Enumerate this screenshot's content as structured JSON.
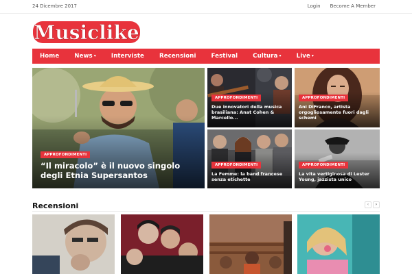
{
  "topbar": {
    "date": "24 Dicembre 2017",
    "login_label": "Login",
    "member_label": "Become A Member"
  },
  "brand": {
    "name": "Musiclike",
    "color": "#e8333c"
  },
  "nav": {
    "items": [
      {
        "label": "Home",
        "dropdown": false
      },
      {
        "label": "News",
        "dropdown": true
      },
      {
        "label": "Interviste",
        "dropdown": false
      },
      {
        "label": "Recensioni",
        "dropdown": false
      },
      {
        "label": "Festival",
        "dropdown": false
      },
      {
        "label": "Cultura",
        "dropdown": true
      },
      {
        "label": "Live",
        "dropdown": true
      }
    ],
    "caret": "▾"
  },
  "featured": {
    "main": {
      "badge": "APPROFONDIMENTI",
      "title": "“Il miracolo” è il nuovo singolo degli Etnia Supersantos"
    },
    "side": [
      {
        "badge": "APPROFONDIMENTI",
        "title": "Due innovatori della musica brasiliana: Anat Cohen & Marcello..."
      },
      {
        "badge": "APPROFONDIMENTI",
        "title": "Ani DiFranco, artista orgogliosamente fuori dagli schemi"
      },
      {
        "badge": "APPROFONDIMENTI",
        "title": "La Femme: la band francese senza etichette"
      },
      {
        "badge": "APPROFONDIMENTI",
        "title": "La vita vertiginosa di Lester Young, jazzista unico"
      }
    ]
  },
  "reviews": {
    "heading": "Recensioni",
    "prev_icon": "‹",
    "next_icon": "›"
  }
}
